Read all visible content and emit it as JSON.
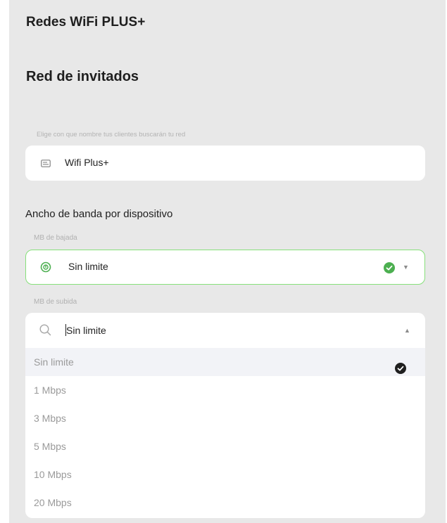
{
  "header": {
    "title": "Redes WiFi PLUS+",
    "subtitle": "Red de invitados"
  },
  "ssid": {
    "hint": "Elige con que nombre tus clientes buscarán tu red",
    "value": "Wifi Plus+"
  },
  "bandwidth": {
    "section_label": "Ancho de banda por dispositivo",
    "download": {
      "label": "MB de bajada",
      "value": "Sin limite"
    },
    "upload": {
      "label": "MB de subida",
      "value": "Sin limite",
      "options": [
        "Sin limite",
        "1 Mbps",
        "3 Mbps",
        "5 Mbps",
        "10 Mbps",
        "20 Mbps"
      ],
      "selected": "Sin limite"
    }
  },
  "colors": {
    "panel_bg": "#e8e8e8",
    "accent_green": "#4caf50",
    "border_green": "#86e07a"
  },
  "icons": [
    "card-icon",
    "speed-icon",
    "check-circle-icon",
    "search-icon",
    "caret-down-icon",
    "caret-up-icon",
    "checkmark-icon"
  ]
}
